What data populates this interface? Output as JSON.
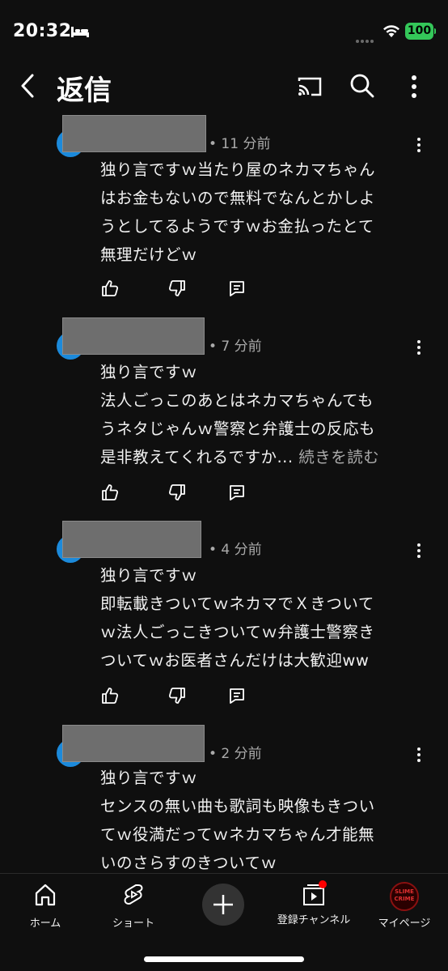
{
  "status_bar": {
    "time": "20:32",
    "battery": "100"
  },
  "header": {
    "title": "返信"
  },
  "comments": [
    {
      "time": "• 11 分前",
      "lines": [
        "独り言ですｗ当たり屋のネカマちゃん",
        "はお金もないので無料でなんとかしよ",
        "うとしてるようですｗお金払ったとて",
        "無理だけどｗ"
      ]
    },
    {
      "time": "• 7 分前",
      "lines": [
        "独り言ですｗ",
        "法人ごっこのあとはネカマちゃんても",
        "うネタじゃんｗ警察と弁護士の反応も",
        "是非教えてくれるですか..."
      ],
      "read_more": " 続きを読む"
    },
    {
      "time": "• 4 分前",
      "lines": [
        "独り言ですｗ",
        "即転載きついてｗネカマでＸきついて",
        "ｗ法人ごっこきついてｗ弁護士警察き",
        "ついてｗお医者さんだけは大歓迎ww"
      ]
    },
    {
      "time": "• 2 分前",
      "lines": [
        "独り言ですｗ",
        "センスの無い曲も歌詞も映像もきつい",
        "てｗ役満だってｗネカマちゃん才能無",
        "いのさらすのきついてｗ"
      ]
    }
  ],
  "bottom_nav": {
    "home": "ホーム",
    "shorts": "ショート",
    "subscriptions": "登録チャンネル",
    "you": "マイページ",
    "avatar_text": "SLIME CRIME"
  },
  "colors": {
    "accent_avatar": "#1c8adb",
    "battery": "#34c759",
    "background": "#0f0f0f"
  }
}
